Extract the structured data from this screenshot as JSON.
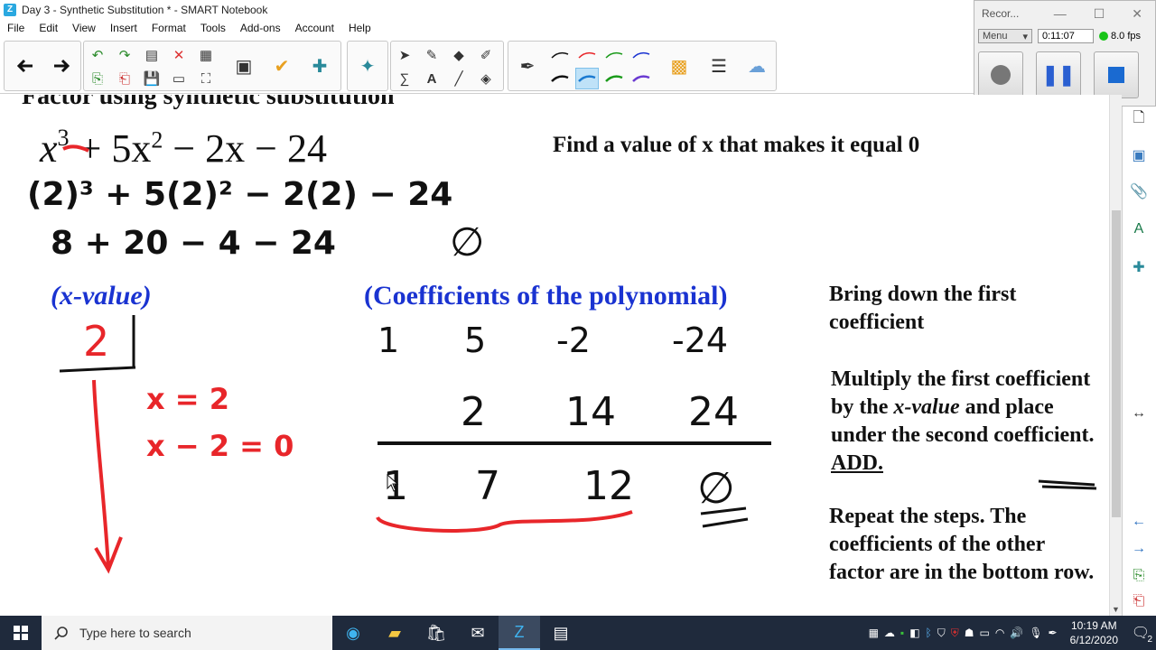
{
  "window": {
    "title": "Day 3 - Synthetic Substitution * - SMART Notebook"
  },
  "menu": [
    "File",
    "Edit",
    "View",
    "Insert",
    "Format",
    "Tools",
    "Add-ons",
    "Account",
    "Help"
  ],
  "recorder": {
    "title": "Recor...",
    "menu_label": "Menu",
    "elapsed": "0:11:07",
    "fps": "8.0 fps"
  },
  "canvas": {
    "cut_title": "Factor using synthetic substitution",
    "polynomial": {
      "x": "x",
      "exp3": "3",
      "mid": "+ 5x",
      "exp2": "2",
      "tail": "− 2x − 24"
    },
    "find_text": "Find a value of x that makes it equal 0",
    "sub_line": "(2)³ + 5(2)² − 2(2) − 24",
    "eval_line": "8 + 20 − 4 − 24",
    "result_mark": "∅",
    "x_value_label": "(x-value)",
    "x_value": "2",
    "eq1": "x = 2",
    "eq2": "x − 2 = 0",
    "coef_label": "(Coefficients of the polynomial)",
    "row1": [
      "1",
      "5",
      "-2",
      "-24"
    ],
    "row2": [
      "2",
      "14",
      "24"
    ],
    "row3": [
      "1",
      "7",
      "12",
      "∅"
    ],
    "step1": "Bring down the first coefficient",
    "step2a": "Multiply the first coefficient by the ",
    "step2_em": "x-value",
    "step2b": " and place under the second coefficient. ",
    "step2_add": "ADD.",
    "step3": "Repeat the steps.  The coefficients of the other factor are in the bottom row."
  },
  "taskbar": {
    "search_placeholder": "Type here to search",
    "time": "10:19 AM",
    "date": "6/12/2020",
    "notifications": "2"
  },
  "colors": {
    "ink_red": "#e8262a",
    "ink_blue": "#1a33d1",
    "taskbar": "#1f2a3c"
  }
}
